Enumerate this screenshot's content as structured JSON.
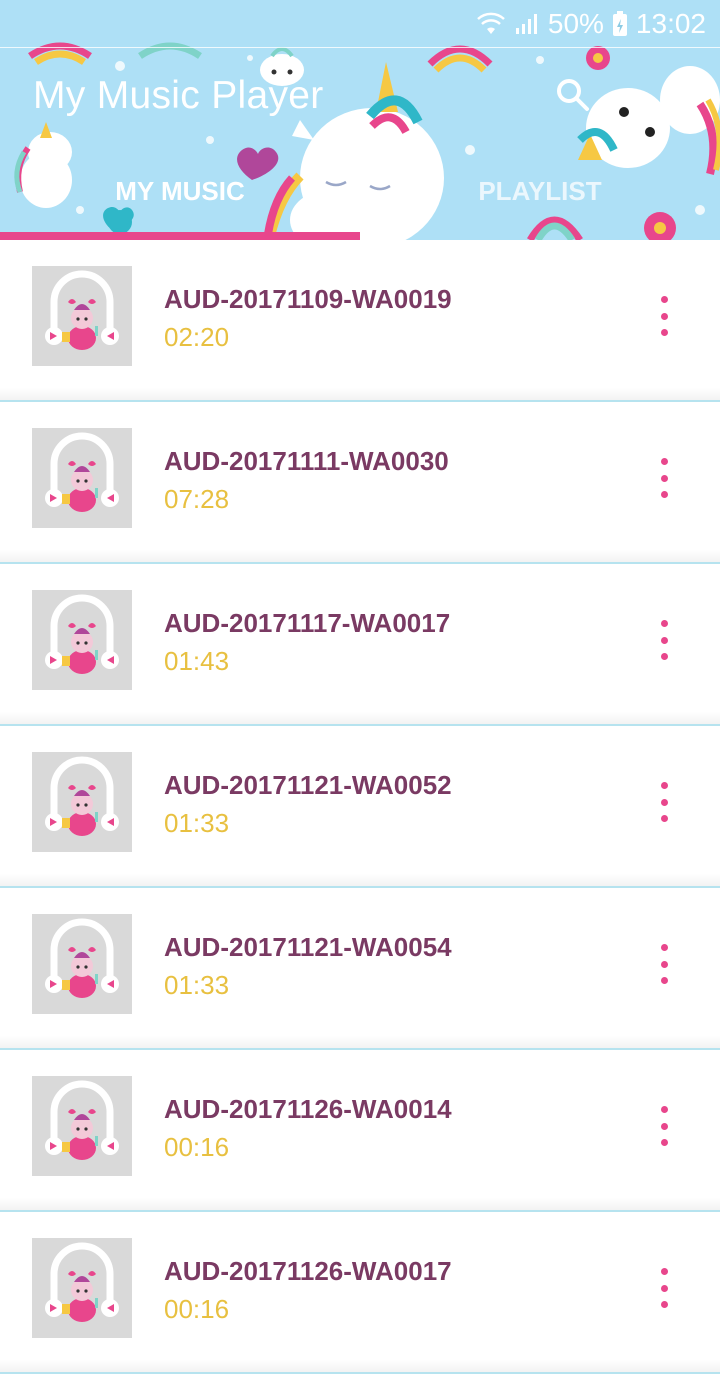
{
  "status_bar": {
    "battery": "50%",
    "time": "13:02"
  },
  "app": {
    "title": "My Music Player"
  },
  "tabs": [
    {
      "label": "MY MUSIC",
      "selected": true
    },
    {
      "label": "PLAYLIST",
      "selected": false
    }
  ],
  "colors": {
    "header_bg": "#aee0f6",
    "accent": "#e8468c",
    "song_title": "#7a3a63",
    "duration": "#e8c040"
  },
  "songs": [
    {
      "title": "AUD-20171109-WA0019",
      "duration": "02:20"
    },
    {
      "title": "AUD-20171111-WA0030",
      "duration": "07:28"
    },
    {
      "title": "AUD-20171117-WA0017",
      "duration": "01:43"
    },
    {
      "title": "AUD-20171121-WA0052",
      "duration": "01:33"
    },
    {
      "title": "AUD-20171121-WA0054",
      "duration": "01:33"
    },
    {
      "title": "AUD-20171126-WA0014",
      "duration": "00:16"
    },
    {
      "title": "AUD-20171126-WA0017",
      "duration": "00:16"
    }
  ]
}
